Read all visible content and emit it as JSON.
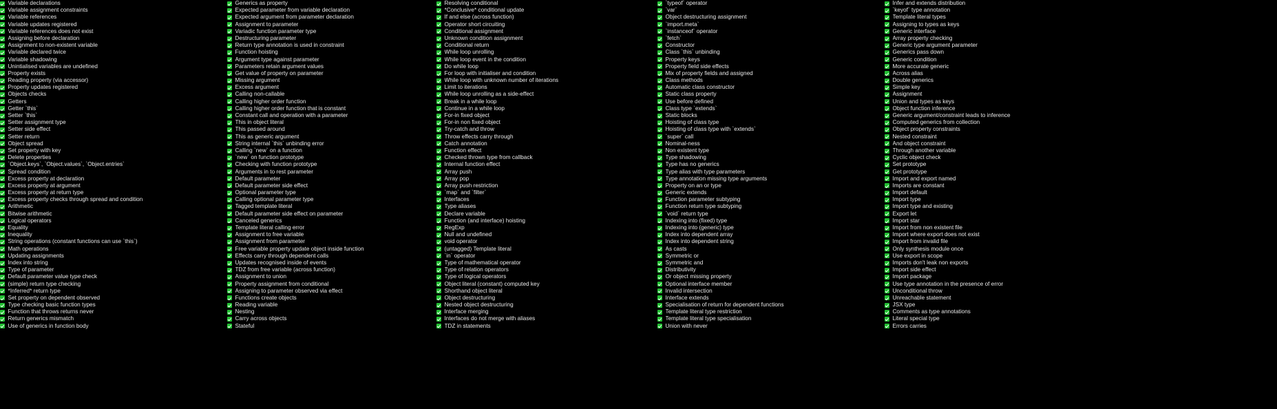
{
  "meta": {
    "background_color": "#000000",
    "text_color": "#e8e8e8",
    "check_color": "#22c032",
    "icon_name": "green-check-icon"
  },
  "columns": [
    {
      "id": "column-1",
      "items": [
        "Variable declarations",
        "Variable assignment constraints",
        "Variable references",
        "Variable updates registered",
        "Variable references does not exist",
        "Assigning before declaration",
        "Assignment to non-existent variable",
        "Variable declared twice",
        "Variable shadowing",
        "Unintialised variables are undefined",
        "Property exists",
        "Reading property (via accessor)",
        "Property updates registered",
        "Objects checks",
        "Getters",
        "Getter `this`",
        "Setter `this`",
        "Setter assignment type",
        "Setter side effect",
        "Setter return",
        "Object spread",
        "Set property with key",
        "Delete properties",
        "`Object.keys`, `Object.values`, `Object.entries`",
        "Spread condition",
        "Excess property at declaration",
        "Excess property at argument",
        "Excess property at return type",
        "Excess property checks through spread and condition",
        "Arithmetic",
        "Bitwise arithmetic",
        "Logical operators",
        "Equality",
        "Inequality",
        "String operations (constant functions can use `this`)",
        "Math operations",
        "Updating assignments",
        "Index into string",
        "Type of parameter",
        "Default parameter value type check",
        "(simple) return type checking",
        "*Inferred* return type",
        "Set property on dependent observed",
        "Type checking basic function types",
        "Function that throws returns never",
        "Return generics mismatch",
        "Use of generics in function body"
      ]
    },
    {
      "id": "column-2",
      "items": [
        "Generics as property",
        "Expected parameter from variable declaration",
        "Expected argument from parameter declaration",
        "Assignment to parameter",
        "Variadic function parameter type",
        "Destructuring parameter",
        "Return type annotation is used in constraint",
        "Function hoisting",
        "Argument type against parameter",
        "Parameters retain argument values",
        "Get value of property on parameter",
        "Missing argument",
        "Excess argument",
        "Calling non-callable",
        "Calling higher order function",
        "Calling higher order function that is constant",
        "Constant call and operation with a parameter",
        "This in object literal",
        "This passed around",
        "This as generic argument",
        "String internal `this` unbinding error",
        "Calling `new` on a function",
        "`new` on function prototype",
        "Checking with function prototype",
        "Arguments in to rest parameter",
        "Default parameter",
        "Default parameter side effect",
        "Optional parameter type",
        "Calling optional parameter type",
        "Tagged template literal",
        "Default parameter side effect on parameter",
        "Canceled generics",
        "Template literal calling error",
        "Assignment to free variable",
        "Assignment from parameter",
        "Free variable property update object inside function",
        "Effects carry through dependent calls",
        "Updates recognised inside of events",
        "TDZ from free variable (across function)",
        "Assignment to union",
        "Property assignment from conditional",
        "Assigning to parameter observed via effect",
        "Functions create objects",
        "Reading variable",
        "Nesting",
        "Carry across objects",
        "Stateful"
      ]
    },
    {
      "id": "column-3",
      "items": [
        "Resolving conditional",
        "*Conclusive* conditional update",
        "If and else (across function)",
        "Operator short circuiting",
        "Conditional assignment",
        "Unknown condition assignment",
        "Conditional return",
        "While loop unrolling",
        "While loop event in the condition",
        "Do while loop",
        "For loop with initialiser and condition",
        "While loop with unknown number of iterations",
        "Limit to iterations",
        "While loop unrolling as a side-effect",
        "Break in a while loop",
        "Continue in a while loop",
        "For-in fixed object",
        "For-in non fixed object",
        "Try-catch and throw",
        "Throw effects carry through",
        "Catch annotation",
        "Function effect",
        "Checked thrown type from callback",
        "Internal function effect",
        "Array push",
        "Array pop",
        "Array push restriction",
        "`map` and `filter`",
        "Interfaces",
        "Type aliases",
        "Declare variable",
        "Function (and interface) hoisting",
        "RegExp",
        "Null and undefined",
        "void operator",
        "(untagged) Template literal",
        "`in` operator",
        "Type of mathematical operator",
        "Type of relation operators",
        "Type of logical operators",
        "Object literal (constant) computed key",
        "Shorthand object literal",
        "Object destructuring",
        "Nested object destructuring",
        "Interface merging",
        "Interfaces do not merge with aliases",
        "TDZ in statements"
      ]
    },
    {
      "id": "column-4",
      "items": [
        "`typeof` operator",
        "`var`",
        "Object destructuring assignment",
        "`import.meta`",
        "`instanceof` operator",
        "`fetch`",
        "Constructor",
        "Class `this` unbinding",
        "Property keys",
        "Property field side effects",
        "Mix of property fields and assigned",
        "Class methods",
        "Automatic class constructor",
        "Static class property",
        "Use before defined",
        "Class type `extends`",
        "Static blocks",
        "Hoisting of class type",
        "Hoisting of class type with `extends`",
        "`super` call",
        "Nominal-ness",
        "Non existent type",
        "Type shadowing",
        "Type has no generics",
        "Type alias with type parameters",
        "Type annotation missing type arguments",
        "Property on an or type",
        "Generic extends",
        "Function parameter subtyping",
        "Function return type subtyping",
        "`void` return type",
        "Indexing into (fixed) type",
        "Indexing into (generic) type",
        "Index into dependent array",
        "Index into dependent string",
        "As casts",
        "Symmetric or",
        "Symmetric and",
        "Distributivity",
        "Or object missing property",
        "Optional interface member",
        "Invalid intersection",
        "Interface extends",
        "Specialisation of return for dependent functions",
        "Template literal type restriction",
        "Template literal type specialisation",
        "Union with never"
      ]
    },
    {
      "id": "column-5",
      "items": [
        "Infer and extends distribution",
        "`keyof` type annotation",
        "Template literal types",
        "Assigning to types as keys",
        "Generic interface",
        "Array property checking",
        "Generic type argument parameter",
        "Generics pass down",
        "Generic condition",
        "More accurate generic",
        "Across alias",
        "Double generics",
        "Simple key",
        "Assignment",
        "Union and types as keys",
        "Object function inference",
        "Generic argument/constraint leads to inference",
        "Computed generics from collection",
        "Object property constraints",
        "Nested constraint",
        "And object constraint",
        "Through another variable",
        "Cyclic object check",
        "Set prototype",
        "Get prototype",
        "Import and export named",
        "Imports are constant",
        "Import default",
        "Import type",
        "Import type and existing",
        "Export let",
        "Import star",
        "Import from non existent file",
        "Import where export does not exist",
        "Import from invalid file",
        "Only synthesis module once",
        "Use export in scope",
        "Imports don't leak non exports",
        "Import side effect",
        "Import package",
        "Use type annotation in the presence of error",
        "Unconditional throw",
        "Unreachable statement",
        "JSX type",
        "Comments as type annotations",
        "Literal special type",
        "Errors carries"
      ]
    }
  ]
}
